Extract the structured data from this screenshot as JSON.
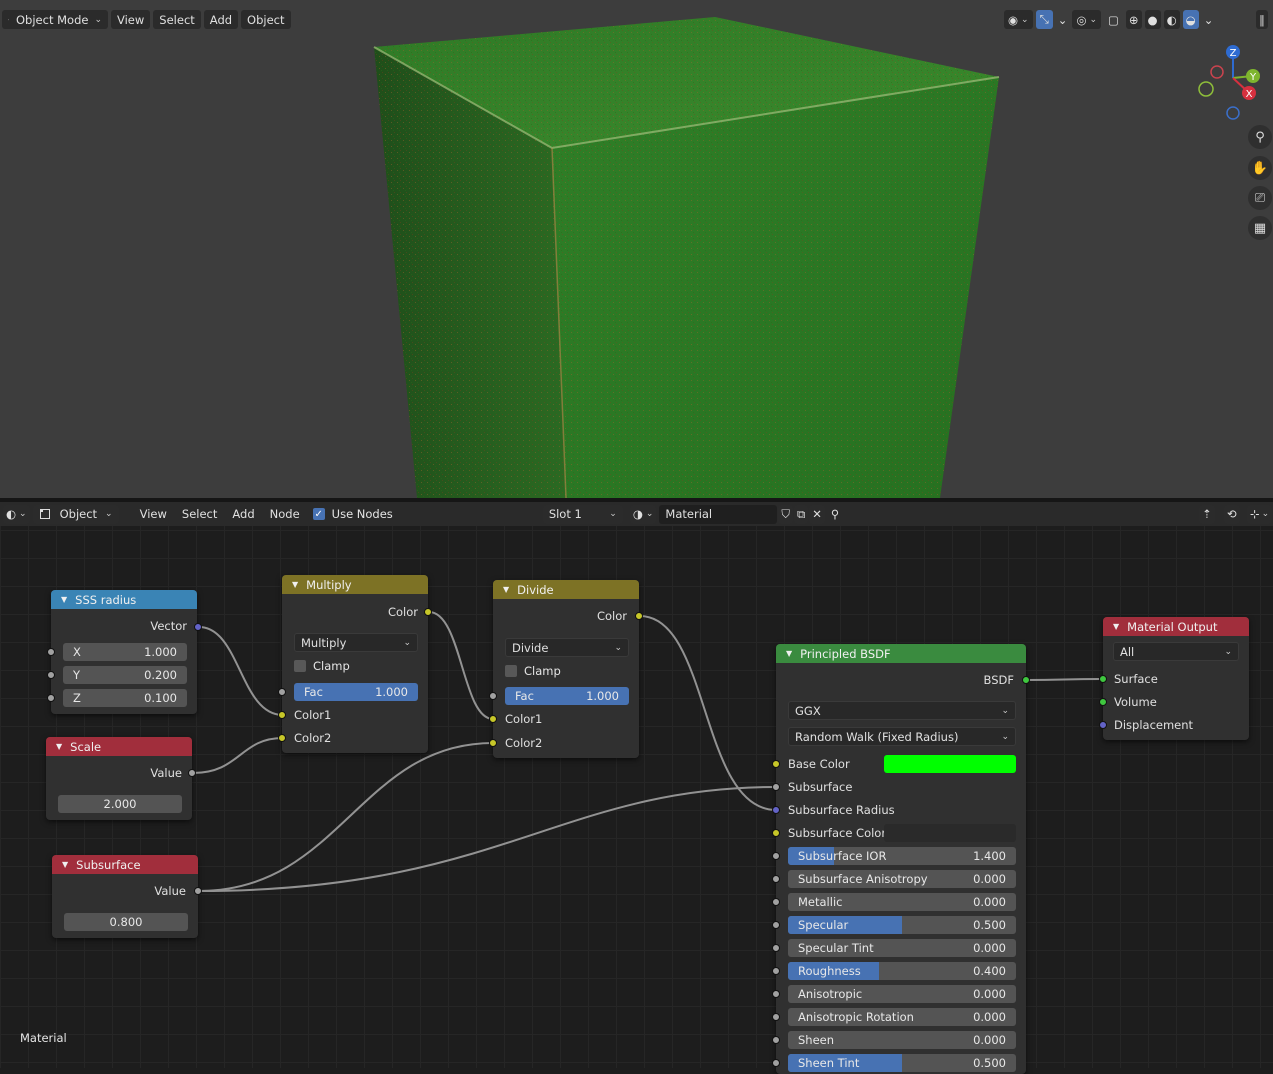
{
  "viewport_header": {
    "mode": "Object Mode",
    "menus": [
      "View",
      "Select",
      "Add",
      "Object"
    ]
  },
  "gizmo": {
    "z": "Z",
    "y": "Y",
    "x": "X"
  },
  "node_header": {
    "editor": "Object",
    "menus": [
      "View",
      "Select",
      "Add",
      "Node"
    ],
    "use_nodes": "Use Nodes",
    "slot": "Slot 1",
    "material": "Material"
  },
  "nodes": {
    "sss_radius": {
      "title": "SSS radius",
      "output": "Vector",
      "x_label": "X",
      "x": "1.000",
      "y_label": "Y",
      "y": "0.200",
      "z_label": "Z",
      "z": "0.100"
    },
    "scale": {
      "title": "Scale",
      "output": "Value",
      "value": "2.000"
    },
    "subsurface": {
      "title": "Subsurface",
      "output": "Value",
      "value": "0.800"
    },
    "multiply": {
      "title": "Multiply",
      "output": "Color",
      "op": "Multiply",
      "clamp": "Clamp",
      "fac_label": "Fac",
      "fac": "1.000",
      "in1": "Color1",
      "in2": "Color2"
    },
    "divide": {
      "title": "Divide",
      "output": "Color",
      "op": "Divide",
      "clamp": "Clamp",
      "fac_label": "Fac",
      "fac": "1.000",
      "in1": "Color1",
      "in2": "Color2"
    },
    "principled": {
      "title": "Principled BSDF",
      "output": "BSDF",
      "distribution": "GGX",
      "sss_method": "Random Walk (Fixed Radius)",
      "base_color_label": "Base Color",
      "base_color": "#00ff00",
      "subsurface": "Subsurface",
      "subsurface_radius": "Subsurface Radius",
      "subsurface_color": "Subsurface Color",
      "params": [
        {
          "label": "Subsurface IOR",
          "value": "1.400",
          "fill": 0.2
        },
        {
          "label": "Subsurface Anisotropy",
          "value": "0.000",
          "fill": 0
        },
        {
          "label": "Metallic",
          "value": "0.000",
          "fill": 0
        },
        {
          "label": "Specular",
          "value": "0.500",
          "fill": 0.5
        },
        {
          "label": "Specular Tint",
          "value": "0.000",
          "fill": 0
        },
        {
          "label": "Roughness",
          "value": "0.400",
          "fill": 0.4
        },
        {
          "label": "Anisotropic",
          "value": "0.000",
          "fill": 0
        },
        {
          "label": "Anisotropic Rotation",
          "value": "0.000",
          "fill": 0
        },
        {
          "label": "Sheen",
          "value": "0.000",
          "fill": 0
        },
        {
          "label": "Sheen Tint",
          "value": "0.500",
          "fill": 0.5
        }
      ]
    },
    "output": {
      "title": "Material Output",
      "target": "All",
      "surface": "Surface",
      "volume": "Volume",
      "displacement": "Displacement"
    }
  },
  "footer_label": "Material"
}
